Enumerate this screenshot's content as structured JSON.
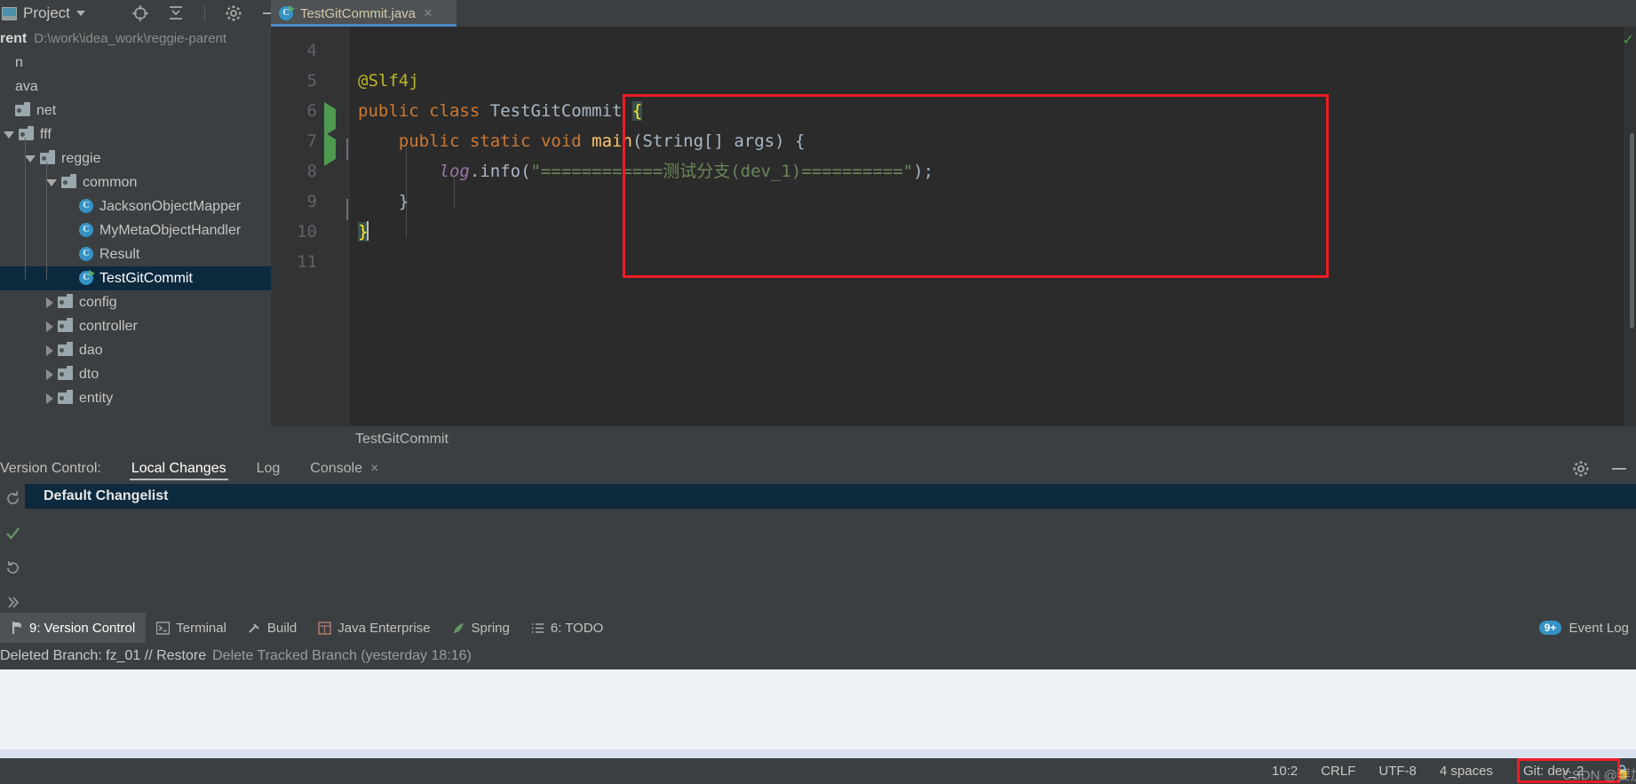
{
  "topbar": {
    "project_label": "Project",
    "icons": [
      "locate-icon",
      "collapse-all-icon",
      "gear-icon",
      "minimize-icon"
    ]
  },
  "editor_tabs": [
    {
      "label": "TestGitCommit.java",
      "icon": "java-class-runnable-icon",
      "close": "×",
      "active": true
    }
  ],
  "project_tree": {
    "root_name": "rent",
    "root_path": "D:\\work\\idea_work\\reggie-parent",
    "items": [
      {
        "label": "n",
        "indent": 0,
        "twist": "none",
        "icon": "none",
        "selected": false
      },
      {
        "label": "ava",
        "indent": 0,
        "twist": "none",
        "icon": "none",
        "selected": false
      },
      {
        "label": "net",
        "indent": 0,
        "twist": "none",
        "icon": "folder",
        "selected": false
      },
      {
        "label": "fff",
        "indent": 0,
        "twist": "open",
        "icon": "folder",
        "selected": false
      },
      {
        "label": "reggie",
        "indent": 1,
        "twist": "open",
        "icon": "folder",
        "selected": false
      },
      {
        "label": "common",
        "indent": 2,
        "twist": "open",
        "icon": "folder",
        "selected": false
      },
      {
        "label": "JacksonObjectMapper",
        "indent": 3,
        "twist": "none",
        "icon": "class",
        "selected": false
      },
      {
        "label": "MyMetaObjectHandler",
        "indent": 3,
        "twist": "none",
        "icon": "class",
        "selected": false
      },
      {
        "label": "Result",
        "indent": 3,
        "twist": "none",
        "icon": "class",
        "selected": false
      },
      {
        "label": "TestGitCommit",
        "indent": 3,
        "twist": "none",
        "icon": "runnable",
        "selected": true
      },
      {
        "label": "config",
        "indent": 2,
        "twist": "closed",
        "icon": "folder",
        "selected": false
      },
      {
        "label": "controller",
        "indent": 2,
        "twist": "closed",
        "icon": "folder",
        "selected": false
      },
      {
        "label": "dao",
        "indent": 2,
        "twist": "closed",
        "icon": "folder",
        "selected": false
      },
      {
        "label": "dto",
        "indent": 2,
        "twist": "closed",
        "icon": "folder",
        "selected": false
      },
      {
        "label": "entity",
        "indent": 2,
        "twist": "closed",
        "icon": "folder",
        "selected": false
      }
    ]
  },
  "code": {
    "lines": [
      {
        "num": "4",
        "gutter": "none",
        "tokens": []
      },
      {
        "num": "5",
        "gutter": "none",
        "tokens": [
          {
            "t": "@Slf4j",
            "c": "ann"
          }
        ]
      },
      {
        "num": "6",
        "gutter": "run",
        "tokens": [
          {
            "t": "public",
            "c": "kw"
          },
          {
            "t": " ",
            "c": "pln"
          },
          {
            "t": "class",
            "c": "kw"
          },
          {
            "t": " ",
            "c": "pln"
          },
          {
            "t": "TestGitCommit",
            "c": "cls"
          },
          {
            "t": " ",
            "c": "pln"
          },
          {
            "t": "{",
            "c": "brace-hl"
          }
        ]
      },
      {
        "num": "7",
        "gutter": "run-fold",
        "tokens": [
          {
            "t": "    ",
            "c": "pln"
          },
          {
            "t": "public",
            "c": "kw"
          },
          {
            "t": " ",
            "c": "pln"
          },
          {
            "t": "static",
            "c": "kw"
          },
          {
            "t": " ",
            "c": "pln"
          },
          {
            "t": "void",
            "c": "kw"
          },
          {
            "t": " ",
            "c": "pln"
          },
          {
            "t": "main",
            "c": "mth"
          },
          {
            "t": "(",
            "c": "pln"
          },
          {
            "t": "String",
            "c": "cls"
          },
          {
            "t": "[] args) {",
            "c": "pln"
          }
        ]
      },
      {
        "num": "8",
        "gutter": "none",
        "tokens": [
          {
            "t": "        ",
            "c": "pln"
          },
          {
            "t": "log",
            "c": "fld"
          },
          {
            "t": ".",
            "c": "pln"
          },
          {
            "t": "info",
            "c": "pln"
          },
          {
            "t": "(",
            "c": "pln"
          },
          {
            "t": "\"============测试分支(dev_1)==========\"",
            "c": "str"
          },
          {
            "t": ");",
            "c": "pln"
          }
        ]
      },
      {
        "num": "9",
        "gutter": "fold-end",
        "tokens": [
          {
            "t": "    }",
            "c": "pln"
          }
        ]
      },
      {
        "num": "10",
        "gutter": "none",
        "tokens": [
          {
            "t": "}",
            "c": "brace-hl"
          }
        ],
        "caret": true
      },
      {
        "num": "11",
        "gutter": "none",
        "tokens": []
      }
    ]
  },
  "breadcrumb": {
    "text": "TestGitCommit"
  },
  "version_control": {
    "title": "Version Control:",
    "tabs": [
      {
        "label": "Local Changes",
        "active": true,
        "closable": false
      },
      {
        "label": "Log",
        "active": false,
        "closable": false
      },
      {
        "label": "Console",
        "active": false,
        "closable": true,
        "close": "×"
      }
    ],
    "changelist": "Default Changelist",
    "header_icons": [
      "gear-icon",
      "minimize-icon"
    ],
    "tool_icons": [
      "refresh-icon",
      "commit-check-icon",
      "rollback-icon",
      "expand-icon"
    ]
  },
  "bottom_tool_windows": [
    {
      "label": "9: Version Control",
      "mnemonic": "9",
      "icon": "branch-icon",
      "active": true
    },
    {
      "label": "Terminal",
      "mnemonic": "",
      "icon": "terminal-icon",
      "active": false
    },
    {
      "label": "Build",
      "mnemonic": "",
      "icon": "hammer-icon",
      "active": false
    },
    {
      "label": "Java Enterprise",
      "mnemonic": "",
      "icon": "java-ee-icon",
      "active": false
    },
    {
      "label": "Spring",
      "mnemonic": "",
      "icon": "spring-leaf-icon",
      "active": false
    },
    {
      "label": "6: TODO",
      "mnemonic": "6",
      "icon": "todo-list-icon",
      "active": false
    }
  ],
  "event_log": {
    "label": "Event Log",
    "badge": "9+"
  },
  "vcs_message": {
    "prefix": "Deleted Branch: fz_01 // Restore",
    "detail": "Delete Tracked Branch (yesterday 18:16)"
  },
  "statusbar": {
    "caret_position": "10:2",
    "line_separator": "CRLF",
    "encoding": "UTF-8",
    "indent": "4 spaces",
    "git_branch": "Git: dev_2",
    "lock_icon": "lock-icon",
    "watermark": "CSDN @要加油!"
  },
  "colors": {
    "accent_blue": "#4a88c7",
    "selection_blue": "#0d293e",
    "highlight_red": "#ee1c25",
    "panel_bg": "#3c3f41",
    "editor_bg": "#2b2b2b"
  }
}
